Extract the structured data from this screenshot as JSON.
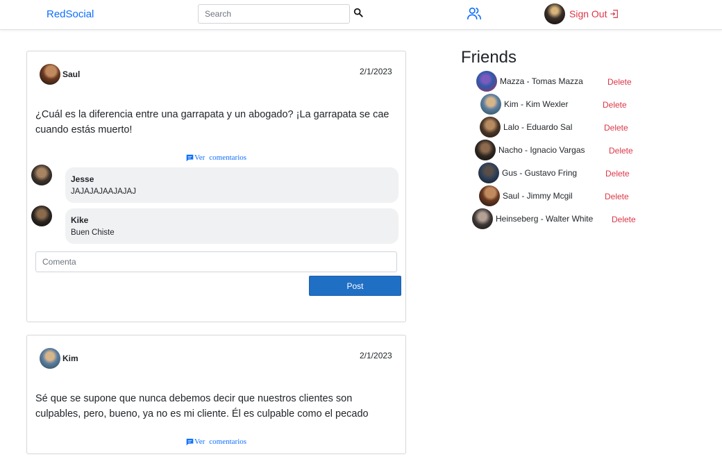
{
  "navbar": {
    "brand": "RedSocial",
    "search_placeholder": "Search",
    "search_icon": "magnifier-icon",
    "friends_icon": "users-icon",
    "signout_label": "Sign Out",
    "signout_icon": "logout-icon"
  },
  "posts": [
    {
      "author": "Saul",
      "date": "2/1/2023",
      "text": "¿Cuál es la diferencia entre una garrapata y un abogado? ¡La garrapata se cae cuando estás muerto!",
      "ver_label": "Ver",
      "comentarios_label": "comentarios",
      "comments": [
        {
          "name": "Jesse",
          "text": "JAJAJAJAAJAJAJ"
        },
        {
          "name": "Kike",
          "text": "Buen Chiste"
        }
      ],
      "comment_placeholder": "Comenta",
      "post_button": "Post"
    },
    {
      "author": "Kim",
      "date": "2/1/2023",
      "text": "Sé que se supone que nunca debemos decir que nuestros clientes son culpables, pero, bueno, ya no es mi cliente. Él es culpable como el pecado",
      "ver_label": "Ver",
      "comentarios_label": "comentarios"
    }
  ],
  "friends": {
    "title": "Friends",
    "delete_label": "Delete",
    "items": [
      {
        "name": "Mazza - Tomas Mazza"
      },
      {
        "name": "Kim - Kim Wexler"
      },
      {
        "name": "Lalo - Eduardo Sal"
      },
      {
        "name": "Nacho - Ignacio Vargas"
      },
      {
        "name": "Gus - Gustavo Fring"
      },
      {
        "name": "Saul - Jimmy Mcgil"
      },
      {
        "name": "Heinseberg - Walter White"
      }
    ]
  },
  "colors": {
    "brand": "#0d6efd",
    "danger": "#dc3545",
    "primary_button": "#1f6fc5",
    "comment_bg": "#f0f1f3"
  }
}
